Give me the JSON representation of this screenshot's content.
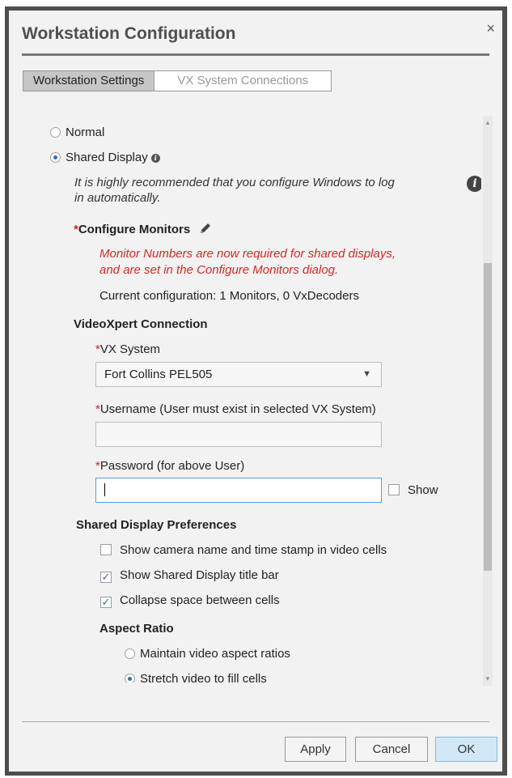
{
  "dialog": {
    "title": "Workstation Configuration",
    "close": "×"
  },
  "tabs": [
    {
      "label": "Workstation Settings",
      "active": true
    },
    {
      "label": "VX System Connections",
      "active": false
    }
  ],
  "mode": {
    "normal_label": "Normal",
    "shared_label": "Shared Display",
    "selected": "Shared Display",
    "auto_login_note": "It is highly recommended that you configure Windows to log in automatically.",
    "auto_login_line1": "It is highly recommended that you configure Windows to log",
    "auto_login_line2": "in automatically."
  },
  "monitors": {
    "heading": "Configure Monitors",
    "warning_line1": "Monitor Numbers are now required for shared displays,",
    "warning_line2": "and are set in the Configure Monitors dialog.",
    "current": "Current configuration: 1 Monitors, 0 VxDecoders"
  },
  "connection": {
    "heading": "VideoXpert Connection",
    "vx_system_label": "VX System",
    "vx_system_value": "Fort Collins PEL505",
    "username_label": "Username (User must exist in selected VX System)",
    "username_value": "",
    "password_label": "Password (for above User)",
    "password_value": "",
    "show_label": "Show",
    "show_checked": false
  },
  "preferences": {
    "heading": "Shared Display Preferences",
    "options": [
      {
        "label": "Show camera name and time stamp in video cells",
        "checked": false
      },
      {
        "label": "Show Shared Display title bar",
        "checked": true
      },
      {
        "label": "Collapse space between cells",
        "checked": true
      }
    ],
    "aspect_heading": "Aspect Ratio",
    "aspect_options": [
      {
        "label": "Maintain video aspect ratios",
        "selected": false
      },
      {
        "label": "Stretch video to fill cells",
        "selected": true
      }
    ]
  },
  "buttons": {
    "apply": "Apply",
    "cancel": "Cancel",
    "ok": "OK"
  },
  "colors": {
    "required": "#cc2222",
    "ok_button": "#d3e8f7",
    "accent": "#2a6fb8"
  }
}
